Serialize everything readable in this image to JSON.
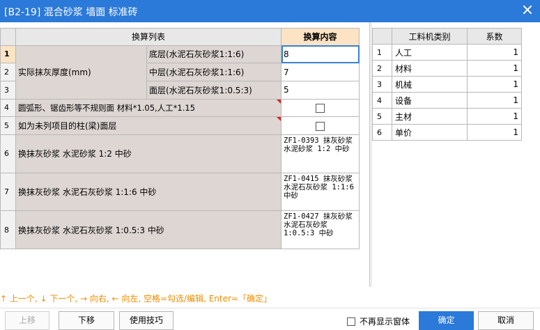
{
  "window": {
    "title": "[B2-19] 混合砂浆 墙面 标准砖"
  },
  "left_table": {
    "headers": {
      "list": "换算列表",
      "content": "换算内容"
    },
    "rows": [
      {
        "no": "1",
        "group": "实际抹灰厚度(mm)",
        "sub": "底层(水泥石灰砂浆1:1:6)",
        "value": "8"
      },
      {
        "no": "2",
        "sub": "中层(水泥石灰砂浆1:1:6)",
        "value": "7"
      },
      {
        "no": "3",
        "sub": "面层(水泥石灰砂浆1:0.5:3)",
        "value": "5"
      },
      {
        "no": "4",
        "label": "圆弧形、锯齿形等不规则面 材料*1.05,人工*1.15"
      },
      {
        "no": "5",
        "label": "如为未列项目的柱(梁)面层"
      },
      {
        "no": "6",
        "label": "换抹灰砂浆 水泥砂浆 1:2 中砂",
        "code": "ZF1-0393  抹灰砂浆 水泥砂浆 1:2 中砂"
      },
      {
        "no": "7",
        "label": "换抹灰砂浆 水泥石灰砂浆 1:1:6 中砂",
        "code": "ZF1-0415  抹灰砂浆 水泥石灰砂浆 1:1:6 中砂"
      },
      {
        "no": "8",
        "label": "换抹灰砂浆 水泥石灰砂浆 1:0.5:3 中砂",
        "code": "ZF1-0427  抹灰砂浆 水泥石灰砂浆 1:0.5:3 中砂"
      }
    ]
  },
  "right_table": {
    "headers": {
      "category": "工料机类别",
      "coef": "系数"
    },
    "rows": [
      {
        "no": "1",
        "category": "人工",
        "coef": "1"
      },
      {
        "no": "2",
        "category": "材料",
        "coef": "1"
      },
      {
        "no": "3",
        "category": "机械",
        "coef": "1"
      },
      {
        "no": "4",
        "category": "设备",
        "coef": "1"
      },
      {
        "no": "5",
        "category": "主材",
        "coef": "1"
      },
      {
        "no": "6",
        "category": "单价",
        "coef": "1"
      }
    ]
  },
  "hint": "↑ 上一个, ↓ 下一个, → 向右, ← 向左, 空格=勾选/编辑, Enter=「确定」",
  "buttons": {
    "up": "上移",
    "down": "下移",
    "tips": "使用技巧",
    "dont_show": "不再显示窗体",
    "ok": "确定",
    "cancel": "取消"
  },
  "colors": {
    "titlebar": "#2b79d8",
    "label_cell": "#ddd6d3",
    "header_highlight": "#fbe3c4",
    "hint_text": "#f08c00"
  }
}
